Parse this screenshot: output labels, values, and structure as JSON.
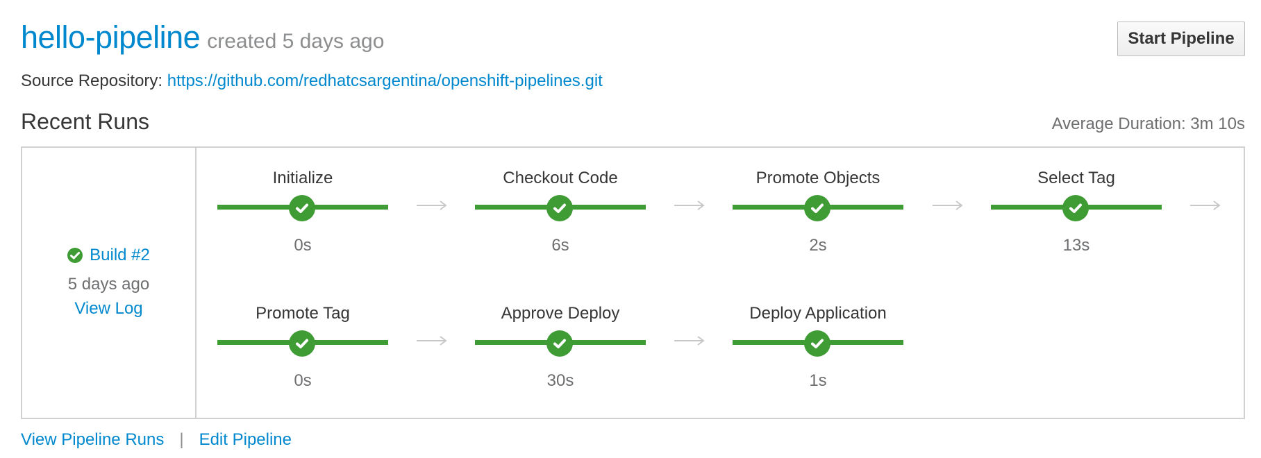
{
  "header": {
    "pipeline_name": "hello-pipeline",
    "created": "created 5 days ago",
    "start_button": "Start Pipeline"
  },
  "source": {
    "label": "Source Repository:",
    "url": "https://github.com/redhatcsargentina/openshift-pipelines.git"
  },
  "recent_runs": {
    "title": "Recent Runs",
    "average_duration": "Average Duration: 3m 10s"
  },
  "build": {
    "status": "success",
    "name": "Build #2",
    "time": "5 days ago",
    "view_log": "View Log"
  },
  "stages": [
    {
      "name": "Initialize",
      "duration": "0s",
      "status": "success"
    },
    {
      "name": "Checkout Code",
      "duration": "6s",
      "status": "success"
    },
    {
      "name": "Promote Objects",
      "duration": "2s",
      "status": "success"
    },
    {
      "name": "Select Tag",
      "duration": "13s",
      "status": "success"
    },
    {
      "name": "Promote Tag",
      "duration": "0s",
      "status": "success"
    },
    {
      "name": "Approve Deploy",
      "duration": "30s",
      "status": "success"
    },
    {
      "name": "Deploy Application",
      "duration": "1s",
      "status": "success"
    }
  ],
  "footer": {
    "view_runs": "View Pipeline Runs",
    "separator": "|",
    "edit": "Edit Pipeline"
  },
  "colors": {
    "link": "#0088ce",
    "success": "#3f9c35",
    "arrow": "#c8c8c8"
  }
}
